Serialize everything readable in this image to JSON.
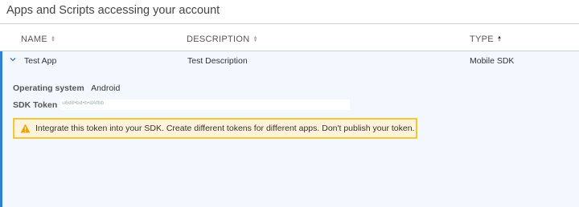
{
  "page": {
    "title": "Apps and Scripts accessing your account"
  },
  "table": {
    "columns": [
      {
        "label": "NAME"
      },
      {
        "label": "DESCRIPTION"
      },
      {
        "label": "TYPE"
      }
    ],
    "rows": [
      {
        "name": "Test App",
        "description": "Test Description",
        "type": "Mobile SDK",
        "details": {
          "os_label": "Operating system",
          "os_value": "Android",
          "token_label": "SDK Token",
          "token_value": "u6d8•bd•b•dAfbb"
        },
        "warning": "Integrate this token into your SDK. Create different tokens for different apps. Don't publish your token."
      }
    ]
  },
  "colors": {
    "accent": "#2f7fd6",
    "expanded_bg": "#f3f8fe",
    "warning_bg": "#fff4d9",
    "warning_border": "#f2c73a"
  },
  "icons": {
    "row_toggle": "chevron-down-icon",
    "warning": "warning-icon"
  }
}
